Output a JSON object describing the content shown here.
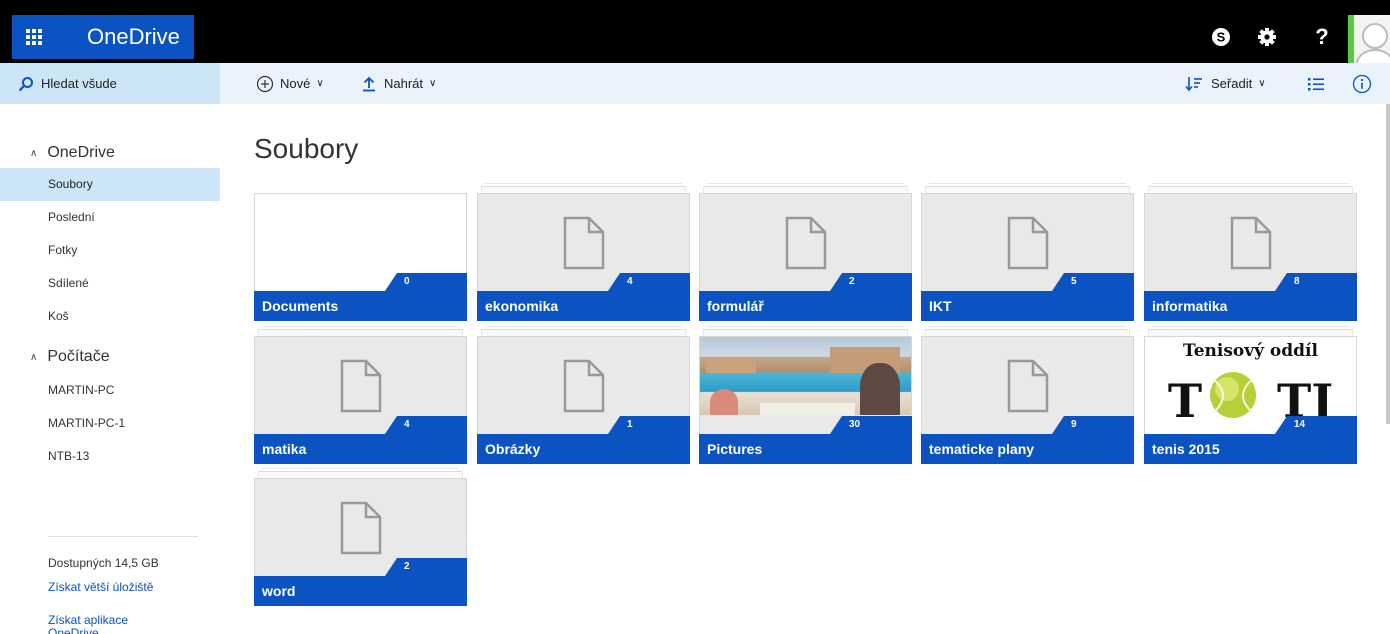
{
  "app": {
    "brand": "OneDrive"
  },
  "header": {
    "skype_icon": "skype-icon",
    "settings_icon": "gear-icon",
    "help_label": "?",
    "avatar_icon": "user-avatar-icon"
  },
  "search": {
    "label": "Hledat všude"
  },
  "commands": {
    "new_label": "Nové",
    "upload_label": "Nahrát",
    "sort_label": "Seřadit"
  },
  "nav": {
    "onedrive_header": "OneDrive",
    "items": [
      {
        "label": "Soubory"
      },
      {
        "label": "Poslední"
      },
      {
        "label": "Fotky"
      },
      {
        "label": "Sdílené"
      },
      {
        "label": "Koš"
      }
    ],
    "pcs_header": "Počítače",
    "pcs": [
      {
        "label": "MARTIN-PC"
      },
      {
        "label": "MARTIN-PC-1"
      },
      {
        "label": "NTB-13"
      }
    ],
    "storage": "Dostupných 14,5 GB",
    "more_storage": "Získat větší úložiště",
    "get_apps": "Získat aplikace",
    "get_apps_2": "OneDrive"
  },
  "main": {
    "title": "Soubory",
    "folders": [
      {
        "name": "Documents",
        "count": "0"
      },
      {
        "name": "ekonomika",
        "count": "4"
      },
      {
        "name": "formulář",
        "count": "2"
      },
      {
        "name": "IKT",
        "count": "5"
      },
      {
        "name": "informatika",
        "count": "8"
      },
      {
        "name": "matika",
        "count": "4"
      },
      {
        "name": "Obrázky",
        "count": "1"
      },
      {
        "name": "Pictures",
        "count": "30"
      },
      {
        "name": "tematicke plany",
        "count": "9"
      },
      {
        "name": "tenis 2015",
        "count": "14"
      },
      {
        "name": "word",
        "count": "2"
      }
    ],
    "tenis_thumbnail_text": "Tenisový oddíl",
    "tenis_logo_left": "T",
    "tenis_logo_right": "TJ"
  },
  "colors": {
    "accent": "#0a53c1",
    "suite_bar": "#000000",
    "command_bar": "#eaf3fc",
    "selected": "#cde6f7",
    "avatar_border": "#5bc640"
  }
}
